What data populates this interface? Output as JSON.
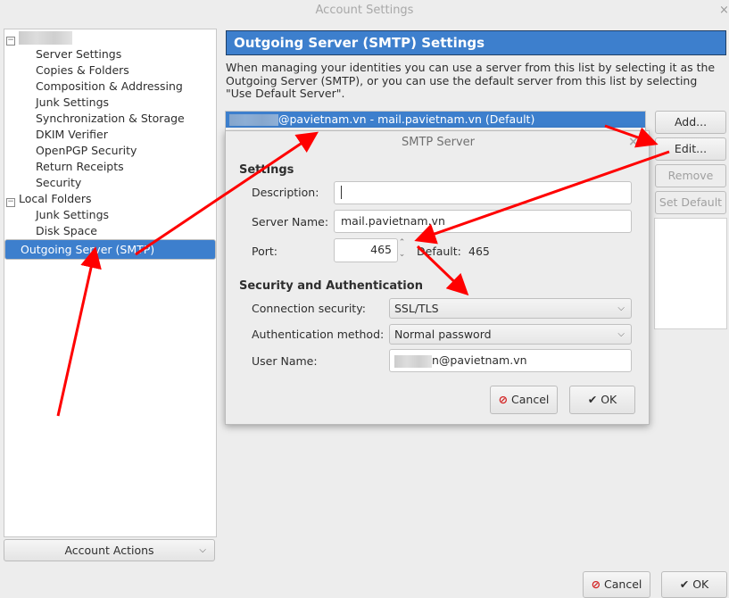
{
  "window": {
    "title": "Account Settings",
    "close": "×"
  },
  "tree": {
    "account_expander": "−",
    "items": [
      {
        "label": "Server Settings"
      },
      {
        "label": "Copies & Folders"
      },
      {
        "label": "Composition & Addressing"
      },
      {
        "label": "Junk Settings"
      },
      {
        "label": "Synchronization & Storage"
      },
      {
        "label": "DKIM Verifier"
      },
      {
        "label": "OpenPGP Security"
      },
      {
        "label": "Return Receipts"
      },
      {
        "label": "Security"
      }
    ],
    "local_folders": {
      "label": "Local Folders",
      "expander": "−",
      "items": [
        {
          "label": "Junk Settings"
        },
        {
          "label": "Disk Space"
        }
      ]
    },
    "selected": "Outgoing Server (SMTP)"
  },
  "account_actions": {
    "label": "Account Actions",
    "chevron": "chevron-down-icon"
  },
  "main": {
    "header": "Outgoing Server (SMTP) Settings",
    "description": "When managing your identities you can use a server from this list by selecting it as the Outgoing Server (SMTP), or you can use the default server from this list by selecting \"Use Default Server\".",
    "server_entry": "@pavietnam.vn - mail.pavietnam.vn (Default)",
    "buttons": {
      "add": "Add...",
      "edit": "Edit...",
      "remove": "Remove",
      "set_default": "Set Default"
    }
  },
  "dialog": {
    "title": "SMTP Server",
    "close": "×",
    "settings_heading": "Settings",
    "description_label": "Description:",
    "description_value": "",
    "server_name_label": "Server Name:",
    "server_name_value": "mail.pavietnam.vn",
    "port_label": "Port:",
    "port_value": "465",
    "default_label": "Default:",
    "default_value": "465",
    "security_heading": "Security and Authentication",
    "connection_security_label": "Connection security:",
    "connection_security_value": "SSL/TLS",
    "auth_method_label": "Authentication method:",
    "auth_method_value": "Normal password",
    "user_name_label": "User Name:",
    "user_name_value": "n@pavietnam.vn",
    "cancel": "Cancel",
    "ok": "OK"
  },
  "footer": {
    "cancel": "Cancel",
    "ok": "OK"
  },
  "colors": {
    "accent": "#3d7fcd",
    "annotation_arrow": "#ff0000"
  }
}
